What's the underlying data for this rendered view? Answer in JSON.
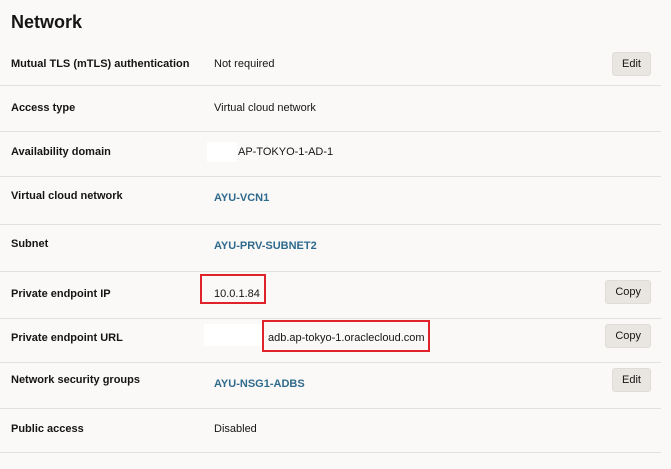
{
  "section": {
    "title": "Network"
  },
  "rows": [
    {
      "label": "Mutual TLS (mTLS) authentication",
      "value": "Not required",
      "action": "Edit"
    },
    {
      "label": "Access type",
      "value": "Virtual cloud network"
    },
    {
      "label": "Availability domain",
      "value": "AP-TOKYO-1-AD-1"
    },
    {
      "label": "Virtual cloud network",
      "value": "AYU-VCN1"
    },
    {
      "label": "Subnet",
      "value": "AYU-PRV-SUBNET2"
    },
    {
      "label": "Private endpoint IP",
      "value": "10.0.1.84",
      "action": "Copy"
    },
    {
      "label": "Private endpoint URL",
      "value": "adb.ap-tokyo-1.oraclecloud.com",
      "action": "Copy"
    },
    {
      "label": "Network security groups",
      "value": "AYU-NSG1-ADBS",
      "action": "Edit"
    },
    {
      "label": "Public access",
      "value": "Disabled"
    }
  ],
  "colors": {
    "link": "#2f6a8d",
    "highlight": "#e0232a",
    "background": "#fbf9f8"
  }
}
